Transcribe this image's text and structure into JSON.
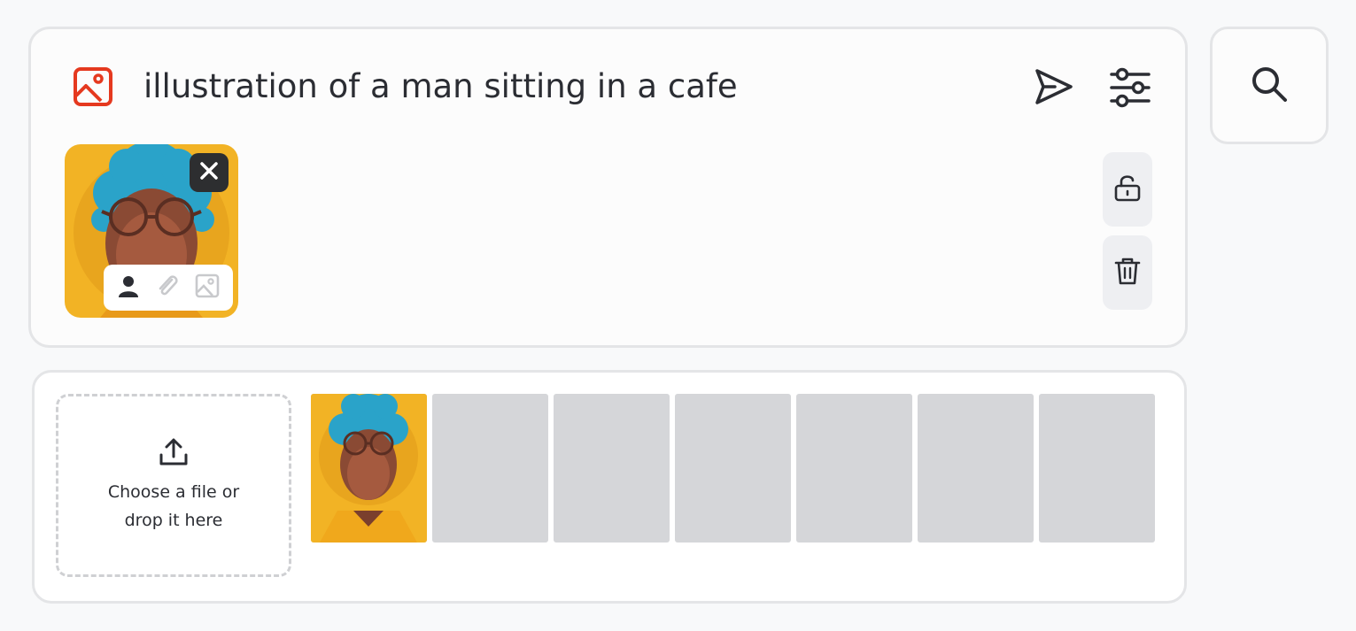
{
  "prompt": {
    "text": "illustration of a man sitting in a cafe",
    "icon": "image-icon",
    "icon_color": "#e5391f"
  },
  "toolbar": {
    "send_icon": "send-icon",
    "settings_icon": "sliders-icon",
    "search_icon": "search-icon"
  },
  "reference": {
    "thumbnail": "portrait of a man with blue curly hair and round glasses on yellow background",
    "modes": [
      {
        "icon": "person-icon",
        "active": true
      },
      {
        "icon": "paperclip-icon",
        "active": false
      },
      {
        "icon": "image-icon",
        "active": false
      }
    ]
  },
  "side_actions": [
    {
      "icon": "unlock-icon"
    },
    {
      "icon": "trash-icon"
    }
  ],
  "upload": {
    "line1": "Choose a file or",
    "line2": "drop it here"
  },
  "gallery": {
    "slots": [
      {
        "filled": true
      },
      {
        "filled": false
      },
      {
        "filled": false
      },
      {
        "filled": false
      },
      {
        "filled": false
      },
      {
        "filled": false
      },
      {
        "filled": false
      }
    ]
  },
  "colors": {
    "accent": "#e5391f",
    "placeholder": "#d5d6d9",
    "thumb_bg": "#f2b325",
    "hair": "#2aa3c9"
  }
}
